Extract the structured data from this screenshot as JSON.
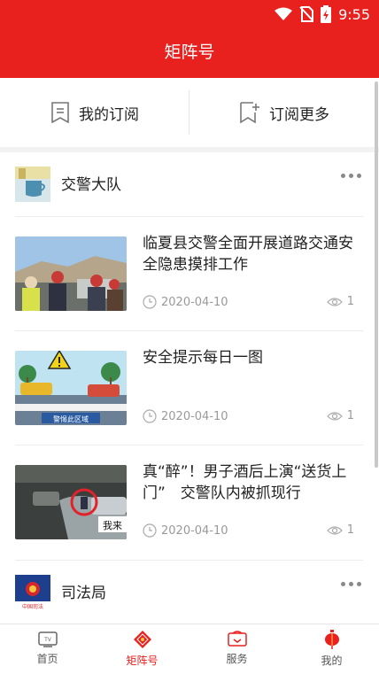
{
  "status_bar": {
    "time": "9:55"
  },
  "header": {
    "title": "矩阵号"
  },
  "subscription": {
    "my_label": "我的订阅",
    "more_label": "订阅更多"
  },
  "feed": {
    "channel1": {
      "name": "交警大队",
      "articles": [
        {
          "title": "临夏县交警全面开展道路交通安全隐患摸排工作",
          "date": "2020-04-10",
          "views": "1"
        },
        {
          "title": "安全提示每日一图",
          "date": "2020-04-10",
          "views": "1",
          "image_text": "警惕此区域"
        },
        {
          "title": "真“醉”！男子酒后上演“送货上门”　交警队内被抓现行",
          "date": "2020-04-10",
          "views": "1",
          "image_text": "我来"
        }
      ]
    },
    "channel2": {
      "name": "司法局",
      "logo_text": "中国司法"
    }
  },
  "bottom_nav": {
    "home": "首页",
    "matrix": "矩阵号",
    "service": "服务",
    "mine": "我的"
  },
  "colors": {
    "brand": "#e8201e",
    "muted": "#999999"
  }
}
